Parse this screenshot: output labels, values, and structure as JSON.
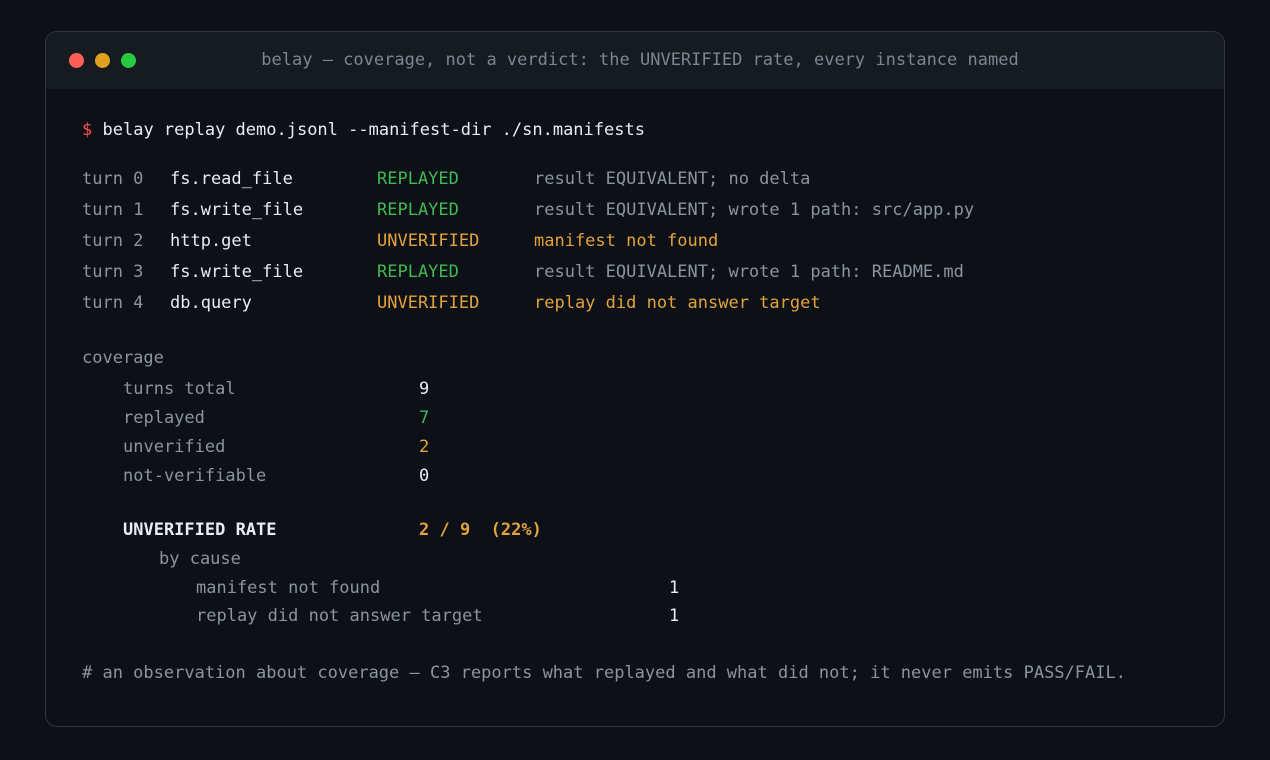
{
  "window": {
    "title": "belay — coverage, not a verdict: the UNVERIFIED rate, every instance named"
  },
  "command": {
    "prompt": "$",
    "text": "belay replay demo.jsonl --manifest-dir ./sn.manifests"
  },
  "turns": [
    {
      "turn": "turn 0",
      "tool": "fs.read_file",
      "status": "REPLAYED",
      "detail": "result EQUIVALENT; no delta"
    },
    {
      "turn": "turn 1",
      "tool": "fs.write_file",
      "status": "REPLAYED",
      "detail": "result EQUIVALENT; wrote 1 path: src/app.py"
    },
    {
      "turn": "turn 2",
      "tool": "http.get",
      "status": "UNVERIFIED",
      "detail": "manifest not found"
    },
    {
      "turn": "turn 3",
      "tool": "fs.write_file",
      "status": "REPLAYED",
      "detail": "result EQUIVALENT; wrote 1 path: README.md"
    },
    {
      "turn": "turn 4",
      "tool": "db.query",
      "status": "UNVERIFIED",
      "detail": "replay did not answer target"
    }
  ],
  "coverage": {
    "heading": "coverage",
    "rows": [
      {
        "label": "turns total",
        "value": "9"
      },
      {
        "label": "replayed",
        "value": "7"
      },
      {
        "label": "unverified",
        "value": "2"
      },
      {
        "label": "not-verifiable",
        "value": "0"
      }
    ],
    "rate_label": "UNVERIFIED RATE",
    "rate_value": "2 / 9  (22%)",
    "by_cause_heading": "by cause",
    "causes": [
      {
        "label": "manifest not found",
        "value": "1"
      },
      {
        "label": "replay did not answer target",
        "value": "1"
      }
    ]
  },
  "footer_comment": "# an observation about coverage — C3 reports what replayed and what did not; it never emits PASS/FAIL.",
  "colors": {
    "background": "#0d1117",
    "replayed": "#3fb950",
    "unverified": "#e3a33a",
    "muted": "#8b949e",
    "prompt": "#f85149"
  }
}
